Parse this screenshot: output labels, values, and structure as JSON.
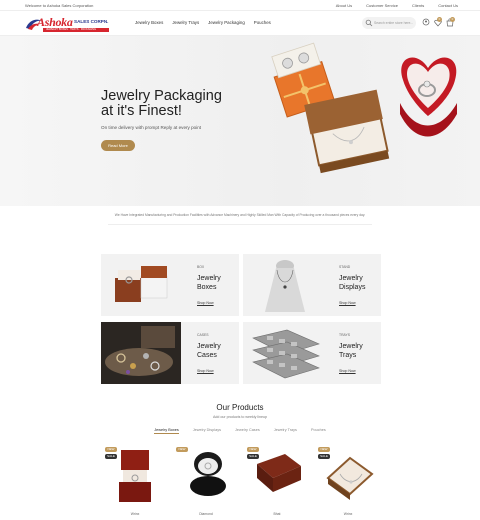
{
  "topbar": {
    "welcome": "Welcome to Ashoka Sales Corporation",
    "links": [
      "About Us",
      "Customer Service",
      "Clients",
      "Contact Us"
    ]
  },
  "header": {
    "logo": {
      "word": "Ashoka",
      "tag": "SALES CORPN.",
      "sub": "JEWELRY BOXES · TRAYS · PACKAGING"
    },
    "nav": [
      "Jewelry Boxes",
      "Jewelry Trays",
      "Jewelry Packaging",
      "Pouches"
    ],
    "search_placeholder": "Search entire store here...",
    "wishlist_count": "0",
    "cart_count": "0"
  },
  "hero": {
    "title": "Jewelry Packaging\nat it's Finest!",
    "subtitle": "On time delivery with prompt Reply at every point",
    "button": "Read More"
  },
  "intro": "We Have Integrated Manufacturing and Production Facilities with Advance Machinery and Highly Skilled Man With Capacity of Producing over a thousand pieces every day.",
  "categories": [
    {
      "tag": "BOX",
      "title": "Jewelry\nBoxes",
      "link": "Shop Now"
    },
    {
      "tag": "STAND",
      "title": "Jewelry\nDisplays",
      "link": "Shop Now"
    },
    {
      "tag": "CASES",
      "title": "Jewelry\nCases",
      "link": "Shop Now"
    },
    {
      "tag": "TRAYS",
      "title": "Jewelry\nTrays",
      "link": "Shop Now"
    }
  ],
  "products_section": {
    "title": "Our Products",
    "subtitle": "Add our products to weekly lineup",
    "tabs": [
      "Jewelry Boxes",
      "Jewelry Displays",
      "Jewelry Cases",
      "Jewelry Trays",
      "Pouches"
    ],
    "items": [
      {
        "badge_new": "NEW",
        "badge_sale": "SALE",
        "name": "Wrinx"
      },
      {
        "badge_new": "NEW",
        "badge_sale": "",
        "name": "Diamond"
      },
      {
        "badge_new": "NEW",
        "badge_sale": "SALE",
        "name": "Bhat"
      },
      {
        "badge_new": "NEW",
        "badge_sale": "SALE",
        "name": "Wrinx"
      }
    ]
  },
  "colors": {
    "accent": "#b08a4e",
    "brand_red": "#d7262f",
    "brand_blue": "#2b3a8f"
  }
}
